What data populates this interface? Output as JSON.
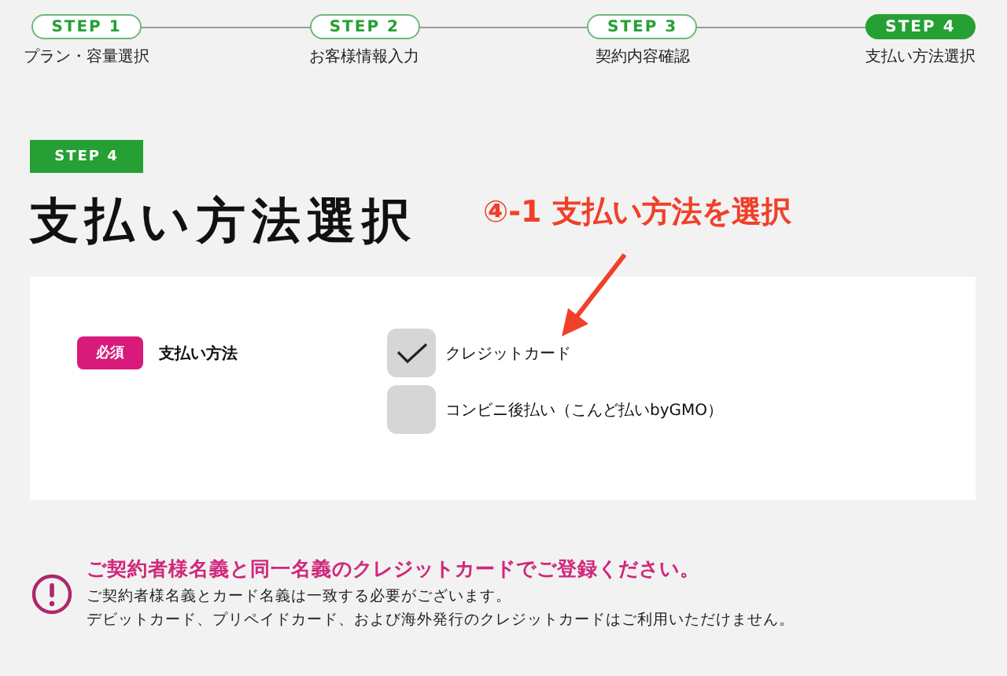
{
  "steps": [
    {
      "badge": "STEP 1",
      "label": "プラン・容量選択",
      "selected": false
    },
    {
      "badge": "STEP 2",
      "label": "お客様情報入力",
      "selected": false
    },
    {
      "badge": "STEP 3",
      "label": "契約内容確認",
      "selected": false
    },
    {
      "badge": "STEP 4",
      "label": "支払い方法選択",
      "selected": true
    }
  ],
  "section": {
    "step_badge": "STEP 4",
    "title": "支払い方法選択"
  },
  "annotation": {
    "text": "④-1 支払い方法を選択"
  },
  "form": {
    "required_badge": "必須",
    "label": "支払い方法",
    "options": [
      {
        "label": "クレジットカード",
        "checked": true
      },
      {
        "label": "コンビニ後払い（こんど払いbyGMO）",
        "checked": false
      }
    ]
  },
  "notice": {
    "heading": "ご契約者様名義と同一名義のクレジットカードでご登録ください。",
    "lines": [
      "ご契約者様名義とカード名義は一致する必要がございます。",
      "デビットカード、プリペイドカード、および海外発行のクレジットカードはご利用いただけません。"
    ]
  }
}
